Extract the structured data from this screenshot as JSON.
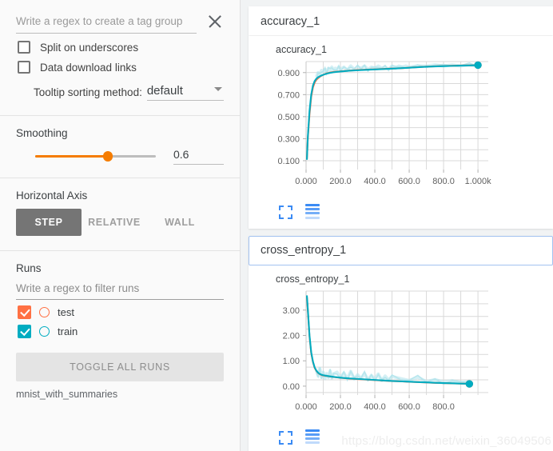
{
  "sidebar": {
    "tag_regex": {
      "placeholder": "Write a regex to create a tag group",
      "value": ""
    },
    "close_icon": "close-icon",
    "checkboxes": [
      {
        "label": "Split on underscores",
        "checked": false
      },
      {
        "label": "Data download links",
        "checked": false
      }
    ],
    "tooltip_sorting": {
      "label": "Tooltip sorting method:",
      "value": "default"
    },
    "smoothing": {
      "title": "Smoothing",
      "value": "0.6",
      "fraction": 0.6,
      "accent": "#f57c00"
    },
    "horizontal_axis": {
      "title": "Horizontal Axis",
      "buttons": [
        {
          "label": "STEP",
          "active": true
        },
        {
          "label": "RELATIVE",
          "active": false
        },
        {
          "label": "WALL",
          "active": false
        }
      ]
    },
    "runs": {
      "title": "Runs",
      "filter_placeholder": "Write a regex to filter runs",
      "filter_value": "",
      "items": [
        {
          "label": "test",
          "color": "#ff7043",
          "checked": true
        },
        {
          "label": "train",
          "color": "#00ACC1",
          "checked": true
        }
      ],
      "toggle_all_label": "TOGGLE ALL RUNS",
      "log_dir": "mnist_with_summaries"
    }
  },
  "main": {
    "cards": [
      {
        "header": "accuracy_1",
        "focused": false,
        "chart": "accuracy"
      },
      {
        "header": "cross_entropy_1",
        "focused": true,
        "chart": "cross_entropy"
      }
    ],
    "chart_icons": {
      "expand": "expand-icon",
      "bars": "data-table-icon"
    },
    "watermark": "https://blog.csdn.net/weixin_36049506"
  },
  "chart_data": [
    {
      "id": "accuracy",
      "type": "line",
      "title": "accuracy_1",
      "xlabel": "",
      "ylabel": "",
      "grid": true,
      "legend": "none",
      "xlim": [
        0,
        1060
      ],
      "ylim": [
        0.02,
        1.0
      ],
      "xticks": [
        0,
        200,
        400,
        600,
        800,
        1000
      ],
      "xticklabels": [
        "0.000",
        "200.0",
        "400.0",
        "600.0",
        "800.0",
        "1.000k"
      ],
      "yticks": [
        0.1,
        0.3,
        0.5,
        0.7,
        0.9
      ],
      "yticklabels": [
        "0.100",
        "0.300",
        "0.500",
        "0.700",
        "0.900"
      ],
      "series": [
        {
          "name": "test",
          "color": "#ff6e40",
          "smoothed": true,
          "endpoint": {
            "x": 1000,
            "y": 0.968
          },
          "x": [
            5,
            10,
            20,
            30,
            40,
            50,
            60,
            70,
            80,
            90,
            100,
            120,
            140,
            160,
            180,
            200,
            250,
            300,
            350,
            400,
            450,
            500,
            550,
            600,
            650,
            700,
            750,
            800,
            850,
            900,
            950,
            1000
          ],
          "y": [
            0.118,
            0.3,
            0.52,
            0.68,
            0.765,
            0.81,
            0.835,
            0.85,
            0.862,
            0.872,
            0.88,
            0.893,
            0.901,
            0.906,
            0.909,
            0.912,
            0.918,
            0.923,
            0.927,
            0.93,
            0.933,
            0.937,
            0.94,
            0.945,
            0.95,
            0.954,
            0.957,
            0.96,
            0.962,
            0.964,
            0.966,
            0.968
          ]
        },
        {
          "name": "train",
          "color": "#00ACC1",
          "smoothed": true,
          "endpoint": {
            "x": 1000,
            "y": 0.968
          },
          "x": [
            5,
            10,
            20,
            30,
            40,
            50,
            60,
            70,
            80,
            90,
            100,
            120,
            140,
            160,
            180,
            200,
            250,
            300,
            350,
            400,
            450,
            500,
            550,
            600,
            650,
            700,
            750,
            800,
            850,
            900,
            950,
            1000
          ],
          "y": [
            0.115,
            0.31,
            0.55,
            0.7,
            0.782,
            0.823,
            0.845,
            0.858,
            0.866,
            0.874,
            0.88,
            0.89,
            0.898,
            0.903,
            0.907,
            0.91,
            0.917,
            0.921,
            0.925,
            0.929,
            0.932,
            0.936,
            0.94,
            0.944,
            0.949,
            0.953,
            0.956,
            0.959,
            0.961,
            0.963,
            0.965,
            0.967
          ]
        },
        {
          "name": "train_raw",
          "color": "#b2e4ec",
          "smoothed": false,
          "note": "unsmoothed noisy background trace",
          "x": [
            60,
            70,
            80,
            90,
            100,
            110,
            120,
            130,
            140,
            150,
            160,
            170,
            180,
            190,
            200,
            220,
            240,
            260,
            280,
            300,
            320,
            340,
            360,
            380,
            400,
            420,
            440,
            460,
            480,
            500,
            520,
            540,
            560,
            580,
            600,
            650,
            700,
            750,
            800,
            850,
            900,
            950,
            1000
          ],
          "y": [
            0.86,
            0.9,
            0.88,
            0.92,
            0.91,
            0.93,
            0.9,
            0.94,
            0.92,
            0.95,
            0.92,
            0.94,
            0.93,
            0.95,
            0.93,
            0.95,
            0.92,
            0.96,
            0.93,
            0.95,
            0.94,
            0.96,
            0.93,
            0.95,
            0.94,
            0.96,
            0.94,
            0.95,
            0.93,
            0.96,
            0.94,
            0.96,
            0.95,
            0.96,
            0.95,
            0.96,
            0.96,
            0.97,
            0.96,
            0.97,
            0.96,
            0.97,
            0.96
          ]
        }
      ]
    },
    {
      "id": "cross_entropy",
      "type": "line",
      "title": "cross_entropy_1",
      "xlabel": "",
      "ylabel": "",
      "grid": true,
      "legend": "none",
      "xlim": [
        0,
        1060
      ],
      "ylim": [
        -0.35,
        3.75
      ],
      "xticks": [
        0,
        200,
        400,
        600,
        800
      ],
      "xticklabels": [
        "0.000",
        "200.0",
        "400.0",
        "600.0",
        "800.0"
      ],
      "yticks": [
        0.0,
        1.0,
        2.0,
        3.0
      ],
      "yticklabels": [
        "0.00",
        "1.00",
        "2.00",
        "3.00"
      ],
      "series": [
        {
          "name": "test",
          "color": "#ff6e40",
          "smoothed": true,
          "endpoint": {
            "x": 950,
            "y": 0.09
          },
          "x": [
            5,
            10,
            20,
            30,
            40,
            50,
            60,
            70,
            80,
            90,
            100,
            120,
            140,
            160,
            200,
            250,
            300,
            350,
            400,
            450,
            500,
            550,
            600,
            650,
            700,
            750,
            800,
            850,
            900,
            950
          ],
          "y": [
            3.5,
            3.0,
            1.95,
            1.3,
            0.95,
            0.72,
            0.6,
            0.52,
            0.47,
            0.44,
            0.42,
            0.4,
            0.38,
            0.36,
            0.33,
            0.3,
            0.28,
            0.26,
            0.24,
            0.22,
            0.2,
            0.19,
            0.17,
            0.16,
            0.145,
            0.13,
            0.12,
            0.11,
            0.1,
            0.09
          ]
        },
        {
          "name": "train",
          "color": "#00ACC1",
          "smoothed": true,
          "endpoint": {
            "x": 950,
            "y": 0.09
          },
          "x": [
            5,
            10,
            20,
            30,
            40,
            50,
            60,
            70,
            80,
            90,
            100,
            120,
            140,
            160,
            200,
            250,
            300,
            350,
            400,
            450,
            500,
            550,
            600,
            650,
            700,
            750,
            800,
            850,
            900,
            950
          ],
          "y": [
            3.55,
            3.05,
            2.0,
            1.33,
            0.97,
            0.74,
            0.61,
            0.53,
            0.48,
            0.45,
            0.43,
            0.405,
            0.385,
            0.365,
            0.335,
            0.305,
            0.285,
            0.265,
            0.245,
            0.225,
            0.205,
            0.19,
            0.175,
            0.16,
            0.148,
            0.133,
            0.122,
            0.112,
            0.102,
            0.092
          ]
        },
        {
          "name": "train_raw",
          "color": "#b2e4ec",
          "smoothed": false,
          "note": "unsmoothed noisy background trace",
          "x": [
            60,
            70,
            80,
            90,
            100,
            110,
            120,
            130,
            140,
            150,
            160,
            180,
            200,
            220,
            240,
            260,
            280,
            300,
            320,
            340,
            360,
            380,
            400,
            420,
            440,
            460,
            480,
            500,
            550,
            600,
            650,
            700,
            750,
            800,
            850,
            900,
            950
          ],
          "y": [
            0.62,
            0.4,
            0.7,
            0.35,
            0.55,
            0.3,
            0.5,
            0.34,
            0.6,
            0.32,
            0.48,
            0.55,
            0.33,
            0.52,
            0.3,
            0.58,
            0.28,
            0.45,
            0.3,
            0.5,
            0.25,
            0.42,
            0.28,
            0.48,
            0.22,
            0.4,
            0.24,
            0.38,
            0.3,
            0.22,
            0.35,
            0.18,
            0.26,
            0.16,
            0.22,
            0.14,
            0.18
          ]
        }
      ]
    }
  ]
}
